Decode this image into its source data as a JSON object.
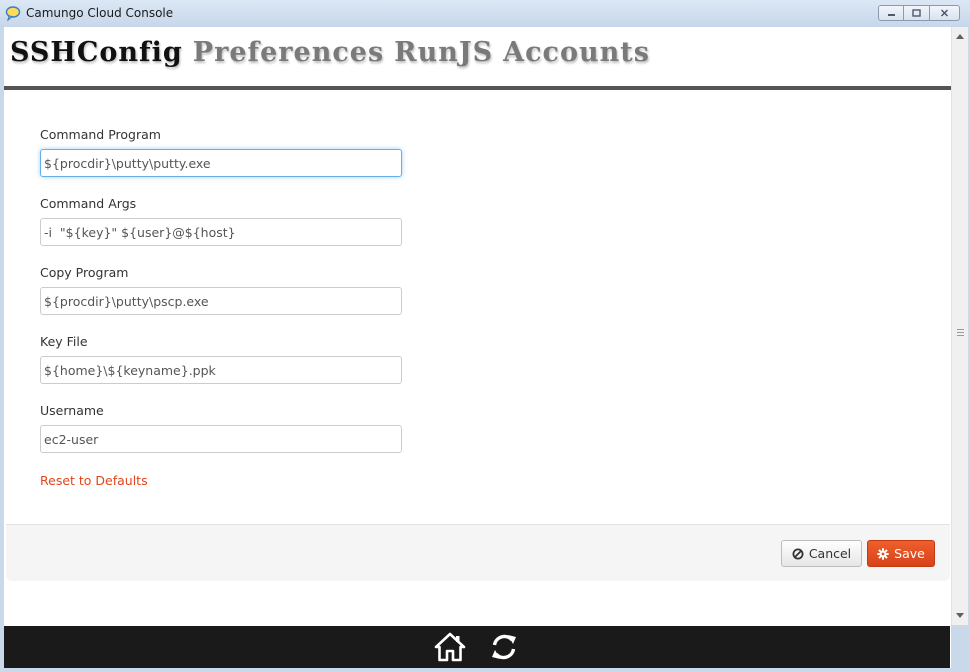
{
  "window": {
    "title": "Camungo Cloud Console",
    "app_icon": "speech-bubble-icon",
    "controls": [
      "minimize-icon",
      "maximize-icon",
      "close-icon"
    ]
  },
  "nav": {
    "items": [
      {
        "label": "SSHConfig",
        "active": true
      },
      {
        "label": "Preferences",
        "active": false
      },
      {
        "label": "RunJS",
        "active": false
      },
      {
        "label": "Accounts",
        "active": false
      }
    ]
  },
  "form": {
    "fields": [
      {
        "label": "Command Program",
        "value": "${procdir}\\putty\\putty.exe",
        "focused": true
      },
      {
        "label": "Command Args",
        "value": "-i  \"${key}\" ${user}@${host}",
        "focused": false
      },
      {
        "label": "Copy Program",
        "value": "${procdir}\\putty\\pscp.exe",
        "focused": false
      },
      {
        "label": "Key File",
        "value": "${home}\\${keyname}.ppk",
        "focused": false
      },
      {
        "label": "Username",
        "value": "ec2-user",
        "focused": false
      }
    ],
    "reset_label": "Reset to Defaults"
  },
  "footer": {
    "cancel_label": "Cancel",
    "cancel_icon": "ban-icon",
    "save_label": "Save",
    "save_icon": "gear-icon"
  },
  "bottom_bar": {
    "icons": [
      "home-icon",
      "refresh-icon"
    ]
  },
  "colors": {
    "accent": "#e2461b",
    "save_button": "#e0501f",
    "focus_border": "#66afe9",
    "bottom_bar": "#1a1a1a"
  }
}
